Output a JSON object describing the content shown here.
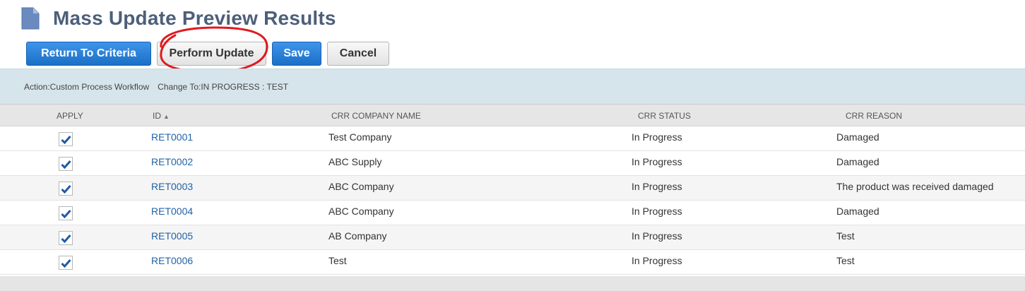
{
  "page": {
    "title": "Mass Update Preview Results",
    "icon": "document-icon"
  },
  "toolbar": {
    "return_label": "Return To Criteria",
    "perform_label": "Perform Update",
    "save_label": "Save",
    "cancel_label": "Cancel"
  },
  "info": {
    "action": "Action:Custom Process Workflow",
    "change_to": "Change To:IN PROGRESS : TEST"
  },
  "table": {
    "headers": {
      "apply": "APPLY",
      "id": "ID",
      "company": "CRR COMPANY NAME",
      "status": "CRR STATUS",
      "reason": "CRR REASON"
    },
    "sort_indicator": "▲",
    "rows": [
      {
        "apply": true,
        "id": "RET0001",
        "company": "Test Company",
        "status": "In Progress",
        "reason": "Damaged"
      },
      {
        "apply": true,
        "id": "RET0002",
        "company": "ABC Supply",
        "status": "In Progress",
        "reason": "Damaged"
      },
      {
        "apply": true,
        "id": "RET0003",
        "company": "ABC Company",
        "status": "In Progress",
        "reason": "The product was received damaged"
      },
      {
        "apply": true,
        "id": "RET0004",
        "company": "ABC Company",
        "status": "In Progress",
        "reason": "Damaged"
      },
      {
        "apply": true,
        "id": "RET0005",
        "company": "AB Company",
        "status": "In Progress",
        "reason": "Test"
      },
      {
        "apply": true,
        "id": "RET0006",
        "company": "Test",
        "status": "In Progress",
        "reason": "Test"
      }
    ]
  },
  "colors": {
    "title": "#4d5f79",
    "primary": "#1e7ad6",
    "link": "#2162a8",
    "info_bar": "#d6e5eb",
    "annotation": "#e0191e"
  }
}
